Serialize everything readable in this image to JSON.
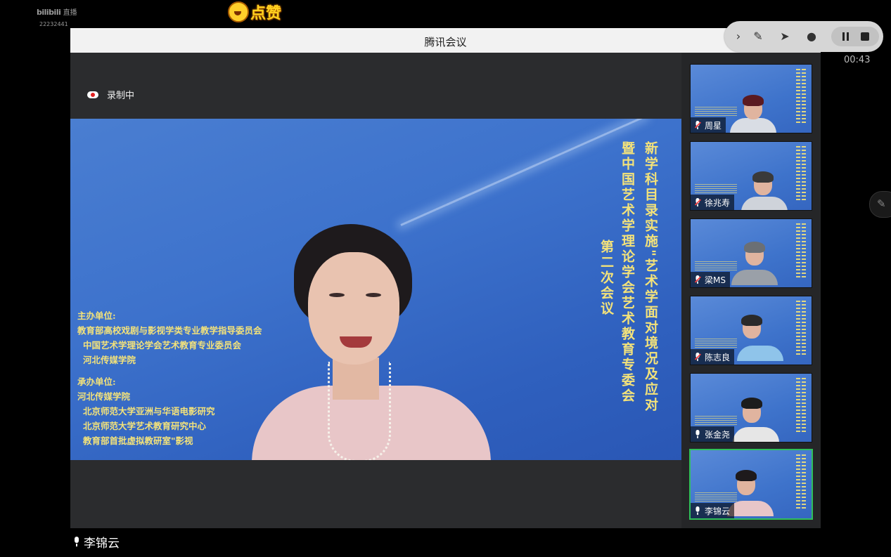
{
  "watermark": {
    "brand": "bilibili",
    "live": "直播",
    "room_id": "22232441"
  },
  "like_badge": {
    "label": "点赞"
  },
  "window": {
    "title": "腾讯会议",
    "close": "✕"
  },
  "recording": {
    "label": "录制中"
  },
  "slide": {
    "title_col1": "新学科目录实施\"艺术学面对境况及应对",
    "title_col2": "暨中国艺术学理论学会艺术教育专委会",
    "title_col3": "第二次会议",
    "host_label": "主办单位:",
    "host_orgs": [
      "教育部高校戏剧与影视学类专业教学指导委员会",
      "中国艺术学理论学会艺术教育专业委员会",
      "河北传媒学院"
    ],
    "organizer_label": "承办单位:",
    "organizer_orgs": [
      "河北传媒学院",
      "北京师范大学亚洲与华语电影研究",
      "北京师范大学艺术教育研究中心",
      "教育部首批虚拟教研室\"影视"
    ]
  },
  "active_speaker": {
    "name": "李锦云"
  },
  "participants": [
    {
      "name": "周星",
      "muted": true
    },
    {
      "name": "徐兆寿",
      "muted": true
    },
    {
      "name": "梁MS",
      "muted": true
    },
    {
      "name": "陈志良",
      "muted": true
    },
    {
      "name": "张金尧",
      "muted": false
    },
    {
      "name": "李锦云",
      "muted": false,
      "active": true
    }
  ],
  "toolbar": {
    "expand_icon": "chevron-right-icon",
    "pen_icon": "pen-icon",
    "pointer_icon": "pointer-icon",
    "person_icon": "person-icon",
    "timer": "00:43"
  },
  "colors": {
    "accent_green": "#2fbf5a",
    "slide_text": "#f3e27a",
    "slide_bg": "#3d72cc"
  }
}
